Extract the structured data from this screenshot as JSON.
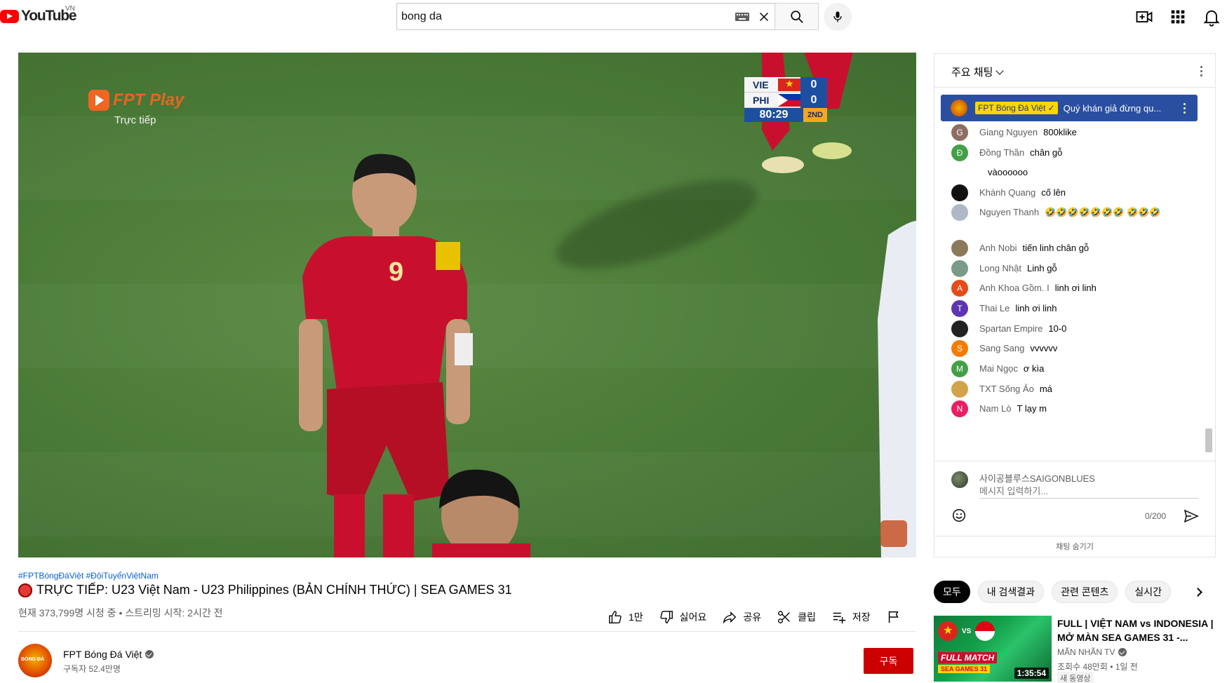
{
  "header": {
    "logo_text": "YouTube",
    "country_code": "VN",
    "search": {
      "value": "bong da",
      "placeholder": ""
    },
    "icons": [
      "keyboard-icon",
      "close-icon",
      "search-icon",
      "mic-icon",
      "create-video-icon",
      "apps-grid-icon",
      "notifications-bell-icon"
    ]
  },
  "player": {
    "broadcaster_name": "FPT Play",
    "broadcaster_sub": "Trực tiếp",
    "scoreboard": {
      "home_team": "VIE",
      "home_score": "0",
      "away_team": "PHI",
      "away_score": "0",
      "clock": "80:29",
      "period": "2ND"
    }
  },
  "video": {
    "hashtags": "#FPTBóngĐáViệt #ĐộiTuyểnViệtNam",
    "title": "TRỰC TIẾP: U23 Việt Nam - U23 Philippines (BẢN CHÍNH THỨC) | SEA GAMES 31",
    "info": "현재 373,799명 시청 중 • 스트리밍 시작: 2시간 전",
    "actions": {
      "like": "1만",
      "dislike": "싫어요",
      "share": "공유",
      "clip": "클립",
      "save": "저장"
    }
  },
  "channel": {
    "name": "FPT Bóng Đá Việt",
    "subscribers": "구독자 52.4만명",
    "subscribe_label": "구독"
  },
  "chat": {
    "mode_label": "주요 채팅",
    "pinned": {
      "badge": "FPT Bóng Đá Việt ✓",
      "text": "Quý khán giả đừng qu..."
    },
    "messages": [
      {
        "author": "Giang Nguyen",
        "text": "800klike",
        "initial": "G",
        "color": "#8d6e63"
      },
      {
        "author": "Đồng Thần",
        "text": "chân gỗ",
        "initial": "Đ",
        "color": "#43a047"
      },
      {
        "author": "",
        "text": "vàoooooo",
        "initial": "",
        "color": "#ffffff"
      },
      {
        "author": "Khánh Quang",
        "text": "cố lên",
        "initial": "",
        "color": "#111111"
      },
      {
        "author": "Nguyen Thanh",
        "text": "🤣🤣🤣🤣🤣🤣🤣 🤣🤣🤣",
        "initial": "",
        "color": "#b0b8c8"
      },
      {
        "author": "Anh Nobi",
        "text": "tiến linh chân gỗ",
        "initial": "",
        "color": "#8a7a5a"
      },
      {
        "author": "Long Nhật",
        "text": "Linh gỗ",
        "initial": "",
        "color": "#7a9a8a"
      },
      {
        "author": "Anh Khoa Gồm. I",
        "text": "linh ơi linh",
        "initial": "A",
        "color": "#e64a19"
      },
      {
        "author": "Thai Le",
        "text": "linh ơi linh",
        "initial": "T",
        "color": "#5e35b1"
      },
      {
        "author": "Spartan Empire",
        "text": "10-0",
        "initial": "",
        "color": "#222222"
      },
      {
        "author": "Sang Sang",
        "text": "vvvvvv",
        "initial": "S",
        "color": "#f57c00"
      },
      {
        "author": "Mai Ngọc",
        "text": "ơ kìa",
        "initial": "M",
        "color": "#43a047"
      },
      {
        "author": "TXT Sống Ảo",
        "text": "má",
        "initial": "",
        "color": "#d4a24a"
      },
      {
        "author": "Nam Lò",
        "text": "T lạy m",
        "initial": "N",
        "color": "#e91e63"
      }
    ],
    "input_user": "사이공블루스SAIGONBLUES",
    "input_placeholder": "메시지 입력하기...",
    "char_count": "0/200",
    "hide_label": "채팅 숨기기"
  },
  "chips": [
    "모두",
    "내 검색결과",
    "관련 콘텐츠",
    "실시간"
  ],
  "recommended": {
    "title": "FULL | VIỆT NAM vs INDONESIA | MỞ MÀN SEA GAMES 31 -...",
    "channel": "MÃN NHÃN TV",
    "meta": "조회수 48만회 • 1일 전",
    "badge": "새 동영상",
    "duration": "1:35:54",
    "thumb_top": "Việt Nam   Indonesia",
    "thumb_banner": "FULL MATCH",
    "thumb_banner2": "SEA GAMES 31"
  }
}
